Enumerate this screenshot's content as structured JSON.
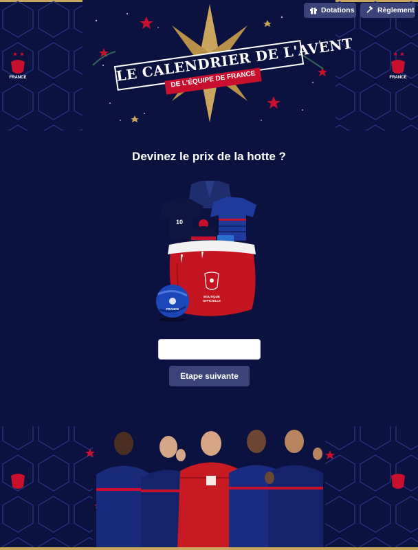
{
  "header": {
    "logo_title": "LE CALENDRIER DE L'AVENT",
    "logo_subtitle": "DE L'ÉQUIPE DE FRANCE",
    "crest_text": "FRANCE"
  },
  "toolbar": {
    "dotations_label": "Dotations",
    "reglement_label": "Règlement"
  },
  "main": {
    "question": "Devinez le prix de la hotte ?",
    "product_badge": "BOUTIQUE OFFICIELLE",
    "ball_text": "FRANCE",
    "price_input_value": "",
    "price_input_placeholder": "",
    "next_button_label": "Etape suivante"
  },
  "colors": {
    "background": "#0c1240",
    "accent_gold": "#c9a55e",
    "button": "#3a4478",
    "red": "#c8102e"
  },
  "icons": [
    "gift-icon",
    "gavel-icon"
  ]
}
